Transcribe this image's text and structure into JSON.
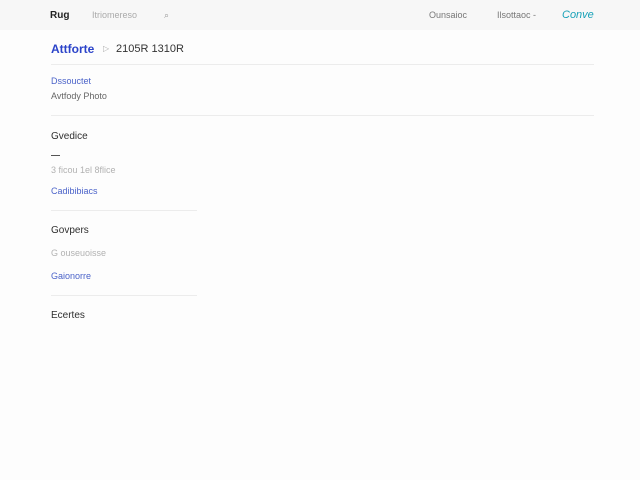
{
  "topbar": {
    "logo": "Rug",
    "search_text": "Itriomereso",
    "links": [
      "Ounsaioc",
      "Ilsottaoc"
    ],
    "link_suffix": "-",
    "brand": "Conve"
  },
  "header": {
    "title": "Attforte",
    "value": "2105R 1310R"
  },
  "details": {
    "label": "Dssouctet",
    "value": "Avtfody Photo"
  },
  "sections": [
    {
      "title": "Gvedice",
      "text": "3 ficou  1el 8flice",
      "link": "Cadibibiacs"
    },
    {
      "title": "Govpers",
      "text": "G ouseuoisse",
      "link": "Gaionorre"
    },
    {
      "title": "Ecertes"
    }
  ],
  "icons": {
    "search": "search-icon",
    "breadcrumb_arrow": "chevron-right-icon"
  }
}
